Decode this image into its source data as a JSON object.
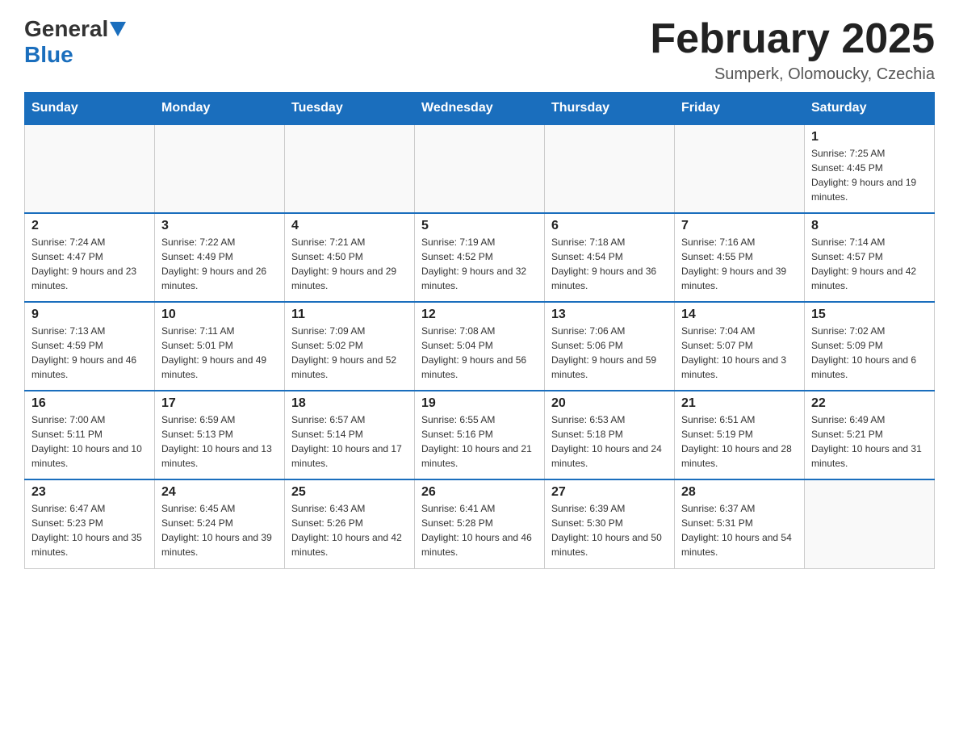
{
  "header": {
    "logo_general": "General",
    "logo_blue": "Blue",
    "month_title": "February 2025",
    "subtitle": "Sumperk, Olomoucky, Czechia"
  },
  "days_of_week": [
    "Sunday",
    "Monday",
    "Tuesday",
    "Wednesday",
    "Thursday",
    "Friday",
    "Saturday"
  ],
  "weeks": [
    [
      {
        "day": "",
        "info": ""
      },
      {
        "day": "",
        "info": ""
      },
      {
        "day": "",
        "info": ""
      },
      {
        "day": "",
        "info": ""
      },
      {
        "day": "",
        "info": ""
      },
      {
        "day": "",
        "info": ""
      },
      {
        "day": "1",
        "info": "Sunrise: 7:25 AM\nSunset: 4:45 PM\nDaylight: 9 hours and 19 minutes."
      }
    ],
    [
      {
        "day": "2",
        "info": "Sunrise: 7:24 AM\nSunset: 4:47 PM\nDaylight: 9 hours and 23 minutes."
      },
      {
        "day": "3",
        "info": "Sunrise: 7:22 AM\nSunset: 4:49 PM\nDaylight: 9 hours and 26 minutes."
      },
      {
        "day": "4",
        "info": "Sunrise: 7:21 AM\nSunset: 4:50 PM\nDaylight: 9 hours and 29 minutes."
      },
      {
        "day": "5",
        "info": "Sunrise: 7:19 AM\nSunset: 4:52 PM\nDaylight: 9 hours and 32 minutes."
      },
      {
        "day": "6",
        "info": "Sunrise: 7:18 AM\nSunset: 4:54 PM\nDaylight: 9 hours and 36 minutes."
      },
      {
        "day": "7",
        "info": "Sunrise: 7:16 AM\nSunset: 4:55 PM\nDaylight: 9 hours and 39 minutes."
      },
      {
        "day": "8",
        "info": "Sunrise: 7:14 AM\nSunset: 4:57 PM\nDaylight: 9 hours and 42 minutes."
      }
    ],
    [
      {
        "day": "9",
        "info": "Sunrise: 7:13 AM\nSunset: 4:59 PM\nDaylight: 9 hours and 46 minutes."
      },
      {
        "day": "10",
        "info": "Sunrise: 7:11 AM\nSunset: 5:01 PM\nDaylight: 9 hours and 49 minutes."
      },
      {
        "day": "11",
        "info": "Sunrise: 7:09 AM\nSunset: 5:02 PM\nDaylight: 9 hours and 52 minutes."
      },
      {
        "day": "12",
        "info": "Sunrise: 7:08 AM\nSunset: 5:04 PM\nDaylight: 9 hours and 56 minutes."
      },
      {
        "day": "13",
        "info": "Sunrise: 7:06 AM\nSunset: 5:06 PM\nDaylight: 9 hours and 59 minutes."
      },
      {
        "day": "14",
        "info": "Sunrise: 7:04 AM\nSunset: 5:07 PM\nDaylight: 10 hours and 3 minutes."
      },
      {
        "day": "15",
        "info": "Sunrise: 7:02 AM\nSunset: 5:09 PM\nDaylight: 10 hours and 6 minutes."
      }
    ],
    [
      {
        "day": "16",
        "info": "Sunrise: 7:00 AM\nSunset: 5:11 PM\nDaylight: 10 hours and 10 minutes."
      },
      {
        "day": "17",
        "info": "Sunrise: 6:59 AM\nSunset: 5:13 PM\nDaylight: 10 hours and 13 minutes."
      },
      {
        "day": "18",
        "info": "Sunrise: 6:57 AM\nSunset: 5:14 PM\nDaylight: 10 hours and 17 minutes."
      },
      {
        "day": "19",
        "info": "Sunrise: 6:55 AM\nSunset: 5:16 PM\nDaylight: 10 hours and 21 minutes."
      },
      {
        "day": "20",
        "info": "Sunrise: 6:53 AM\nSunset: 5:18 PM\nDaylight: 10 hours and 24 minutes."
      },
      {
        "day": "21",
        "info": "Sunrise: 6:51 AM\nSunset: 5:19 PM\nDaylight: 10 hours and 28 minutes."
      },
      {
        "day": "22",
        "info": "Sunrise: 6:49 AM\nSunset: 5:21 PM\nDaylight: 10 hours and 31 minutes."
      }
    ],
    [
      {
        "day": "23",
        "info": "Sunrise: 6:47 AM\nSunset: 5:23 PM\nDaylight: 10 hours and 35 minutes."
      },
      {
        "day": "24",
        "info": "Sunrise: 6:45 AM\nSunset: 5:24 PM\nDaylight: 10 hours and 39 minutes."
      },
      {
        "day": "25",
        "info": "Sunrise: 6:43 AM\nSunset: 5:26 PM\nDaylight: 10 hours and 42 minutes."
      },
      {
        "day": "26",
        "info": "Sunrise: 6:41 AM\nSunset: 5:28 PM\nDaylight: 10 hours and 46 minutes."
      },
      {
        "day": "27",
        "info": "Sunrise: 6:39 AM\nSunset: 5:30 PM\nDaylight: 10 hours and 50 minutes."
      },
      {
        "day": "28",
        "info": "Sunrise: 6:37 AM\nSunset: 5:31 PM\nDaylight: 10 hours and 54 minutes."
      },
      {
        "day": "",
        "info": ""
      }
    ]
  ]
}
